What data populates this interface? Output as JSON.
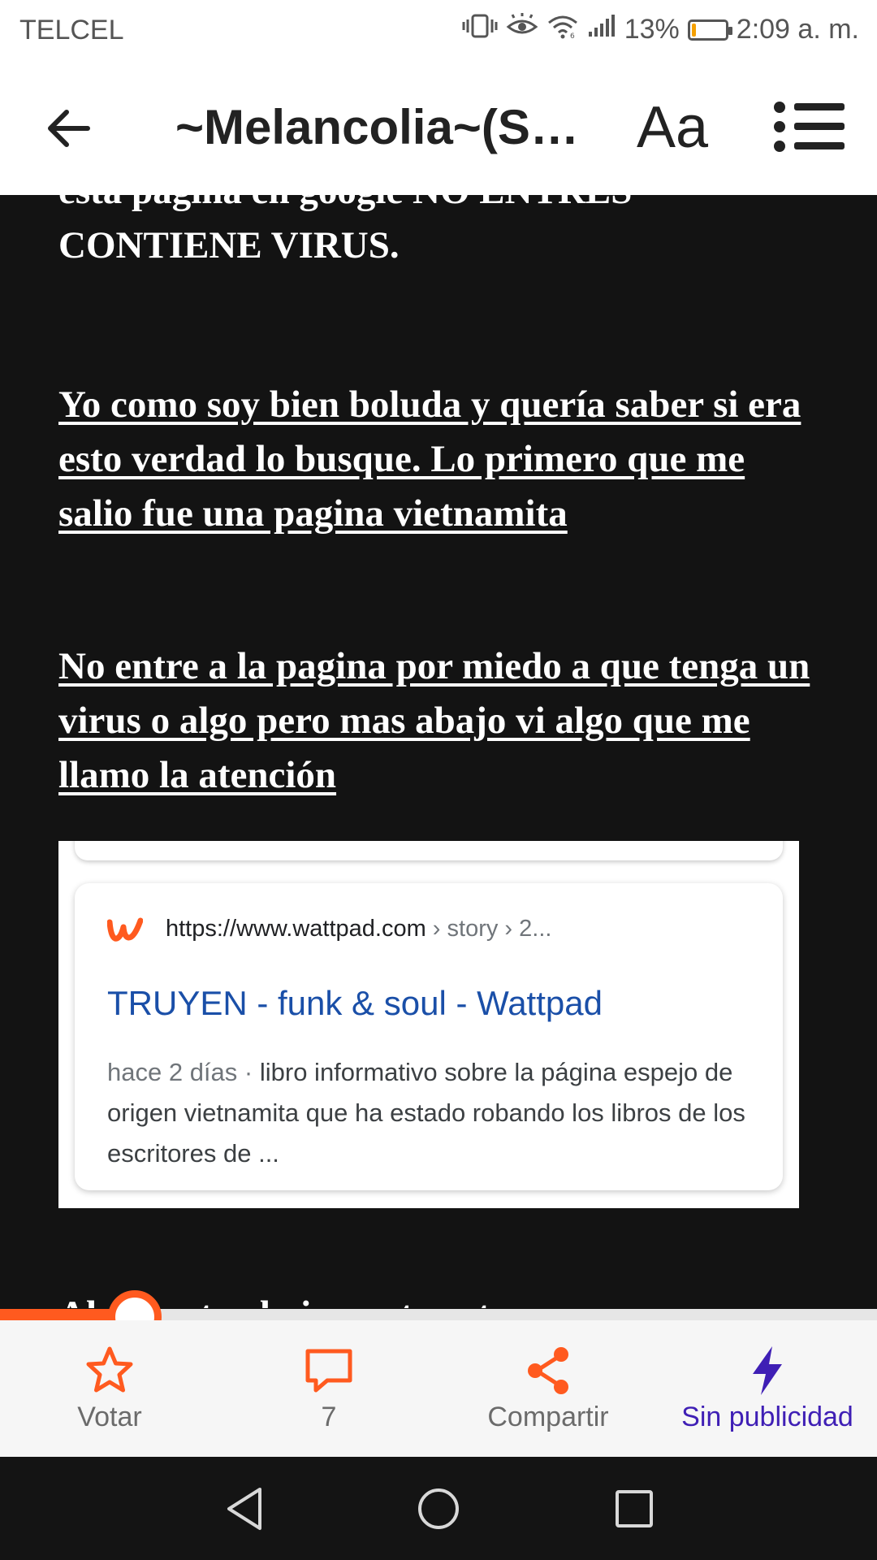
{
  "status_bar": {
    "carrier": "TELCEL",
    "battery_percent": "13%",
    "time": "2:09 a. m.",
    "battery_level": 0.13,
    "icons": [
      "vibrate-icon",
      "eye-comfort-icon",
      "wifi-icon",
      "signal-icon",
      "battery-icon"
    ]
  },
  "header": {
    "title": "~Melancolia~(Su...",
    "font_button_label": "Aa",
    "icons": [
      "back-arrow-icon",
      "table-of-contents-icon"
    ]
  },
  "content": {
    "top_cut_line": "esta pagina en google NO ENTRES",
    "top_line": "CONTIENE VIRUS.",
    "paragraph_1": "Yo como soy bien boluda y quería saber si era esto verdad lo busque. Lo primero que me salio fue una pagina vietnamita ",
    "paragraph_2": "No entre a la pagina por miedo a que tenga un virus o algo pero mas abajo vi algo que me llamo la atención ",
    "paragraph_3": "Al ver esto obviamente entre para"
  },
  "search_result": {
    "url": "https://www.wattpad.com",
    "breadcrumb": " › story › 2...",
    "title": "TRUYEN - funk & soul - Wattpad",
    "date": "hace 2 días",
    "separator": " · ",
    "snippet": "libro informativo sobre la página espejo de origen vietnamita que ha estado robando los libros de los escritores de  ...",
    "colors": {
      "title": "#1a4fa8",
      "logo": "#ff5a1f"
    }
  },
  "reading_progress": 0.145,
  "actions": {
    "vote": "Votar",
    "comments": "7",
    "share": "Compartir",
    "no_ads": "Sin publicidad"
  },
  "colors": {
    "accent": "#ff5a1f",
    "premium": "#3f1fb5",
    "background": "#131313"
  },
  "navigation": {
    "icons": [
      "back-triangle-icon",
      "home-circle-icon",
      "recents-square-icon"
    ]
  }
}
